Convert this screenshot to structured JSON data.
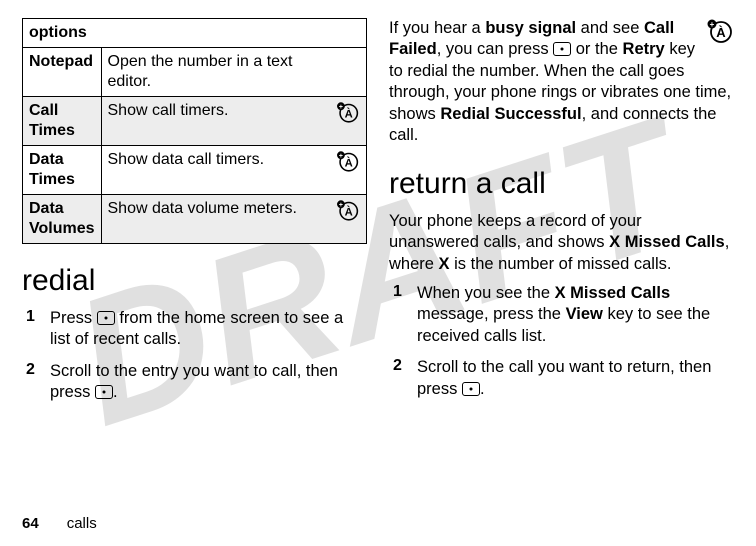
{
  "watermark": "DRAFT",
  "left": {
    "table": {
      "header": "options",
      "rows": [
        {
          "label": "Notepad",
          "desc": "Open the number in a text editor.",
          "icon": false,
          "shade": false
        },
        {
          "label": "Call Times",
          "desc": "Show call timers.",
          "icon": true,
          "shade": true
        },
        {
          "label": "Data Times",
          "desc": "Show data call timers.",
          "icon": true,
          "shade": false
        },
        {
          "label": "Data Volumes",
          "desc": "Show data volume meters.",
          "icon": true,
          "shade": true
        }
      ]
    },
    "heading": "redial",
    "steps": [
      {
        "n": "1",
        "pre": "Press ",
        "post": " from the home screen to see a list of recent calls."
      },
      {
        "n": "2",
        "pre": "Scroll to the entry you want to call, then press ",
        "post": "."
      }
    ]
  },
  "right": {
    "intro": {
      "t1": "If you hear a ",
      "busy": "busy signal",
      "t2": " and see ",
      "cf": "Call Failed",
      "t3": ", you can press ",
      "t4": " or the ",
      "retry": "Retry",
      "t5": " key to redial the number. When the call goes through, your phone rings or vibrates one time, shows ",
      "rs": "Redial Successful",
      "t6": ", and connects the call."
    },
    "heading": "return a call",
    "body": {
      "t1": "Your phone keeps a record of your unanswered calls, and shows ",
      "xmc": "X Missed Calls",
      "t2": ", where ",
      "x": "X",
      "t3": " is the number of missed calls."
    },
    "steps": [
      {
        "n": "1",
        "t1": "When you see the ",
        "xmc": "X Missed Calls",
        "t2": " message, press the ",
        "view": "View",
        "t3": " key to see the received calls list."
      },
      {
        "n": "2",
        "t1": "Scroll to the call you want to return, then press ",
        "t2": "."
      }
    ]
  },
  "footer": {
    "page": "64",
    "section": "calls"
  }
}
